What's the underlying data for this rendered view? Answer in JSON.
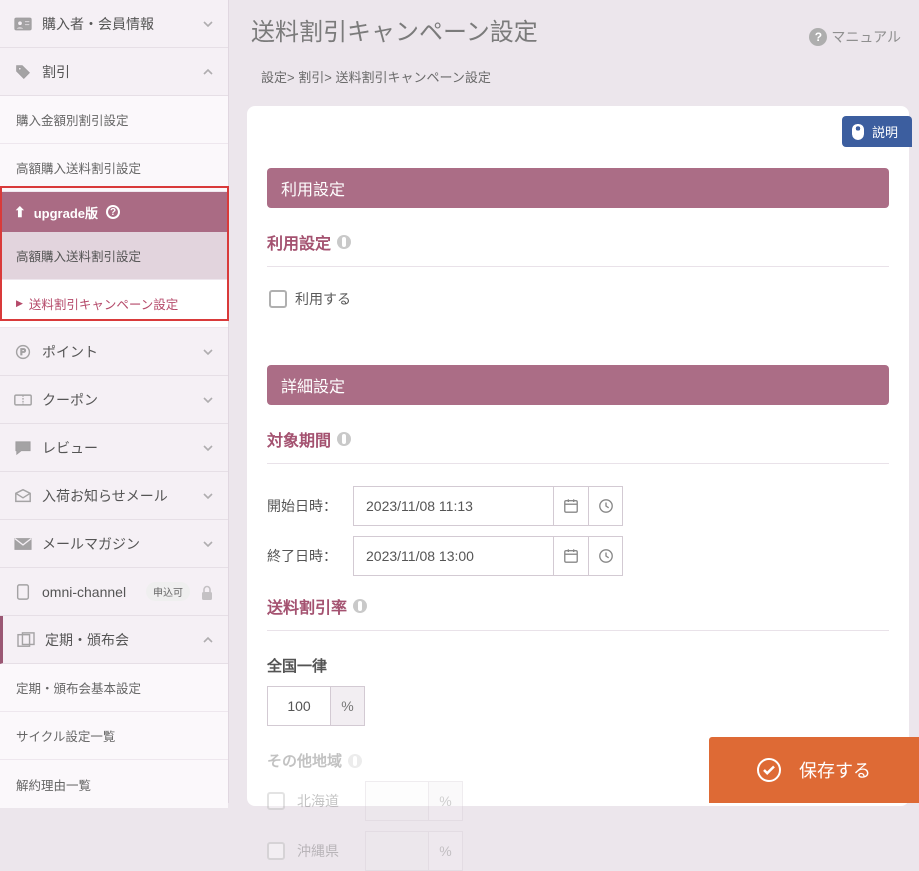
{
  "sidebar": {
    "buyer": "購入者・会員情報",
    "discount": "割引",
    "discount_children": {
      "amount": "購入金額別割引設定",
      "high": "高額購入送料割引設定"
    },
    "upgrade_label": "upgrade版",
    "upgrade_children": {
      "high": "高額購入送料割引設定",
      "campaign": "送料割引キャンペーン設定"
    },
    "point": "ポイント",
    "coupon": "クーポン",
    "review": "レビュー",
    "restock": "入荷お知らせメール",
    "magazine": "メールマガジン",
    "omni": "omni-channel",
    "omni_pill": "申込可",
    "subscription": "定期・頒布会",
    "subscription_children": {
      "basic": "定期・頒布会基本設定",
      "cycle": "サイクル設定一覧",
      "cancel": "解約理由一覧"
    }
  },
  "header": {
    "title": "送料割引キャンペーン設定",
    "manual": "マニュアル"
  },
  "breadcrumb": {
    "a": "設定",
    "b": "割引",
    "c": "送料割引キャンペーン設定"
  },
  "explain_badge": "説明",
  "sections": {
    "usage_bar": "利用設定",
    "usage_h": "利用設定",
    "use_label": "利用する",
    "detail_bar": "詳細設定",
    "period_h": "対象期間",
    "start_lbl": "開始日時：",
    "end_lbl": "終了日時：",
    "start_val": "2023/11/08 11:13",
    "end_val": "2023/11/08 13:00",
    "rate_h": "送料割引率",
    "nationwide": "全国一律",
    "nationwide_val": "100",
    "other_region_h": "その他地域",
    "hokkaido": "北海道",
    "okinawa": "沖縄県",
    "pct": "%"
  },
  "save_label": "保存する"
}
